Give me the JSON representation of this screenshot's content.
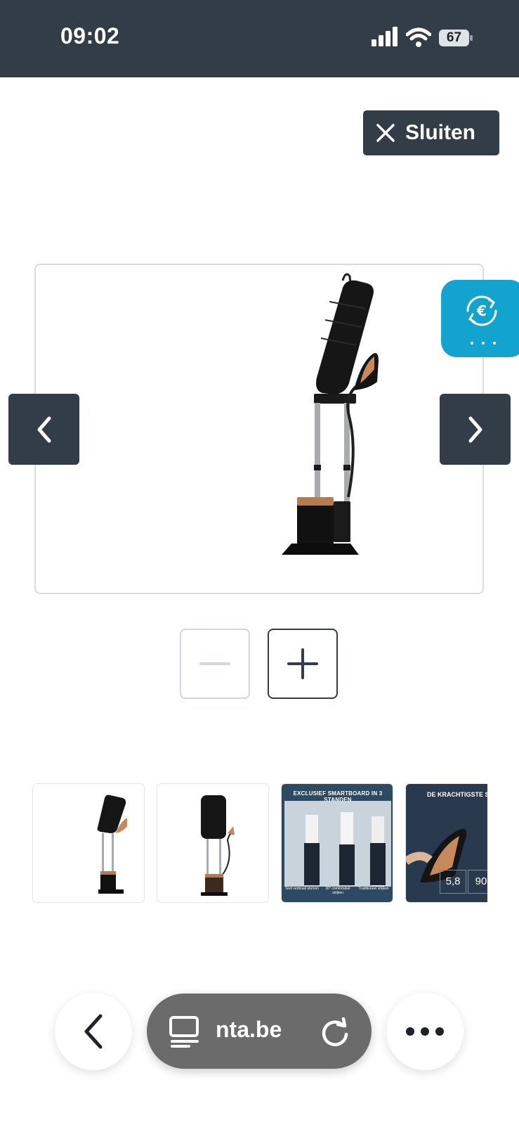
{
  "status_bar": {
    "time": "09:02",
    "battery": "67"
  },
  "close_button": {
    "label": "Sluiten"
  },
  "thumbnails": [
    {
      "caption": ""
    },
    {
      "caption": ""
    },
    {
      "caption": "EXCLUSIEF SMARTBOARD IN 3 STANDEN",
      "tags": [
        "Snel verticaal stomen",
        "30° comfortabel strijken",
        "Traditioneel strijken"
      ]
    },
    {
      "caption": "DE KRACHTIGSTE ST",
      "stats": [
        "5,8",
        "90"
      ]
    }
  ],
  "browser": {
    "url": "nta.be"
  },
  "colors": {
    "dark": "#333d47",
    "accent": "#12a4cf",
    "pill": "#6b6b6b",
    "copper": "#c8895a"
  }
}
